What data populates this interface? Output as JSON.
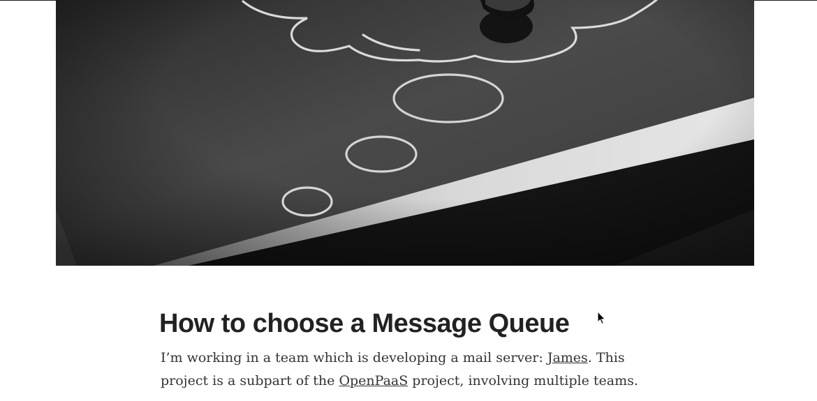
{
  "hero_image": {
    "alt": "",
    "icon": "chalkboard-thought-bubble-image"
  },
  "post": {
    "title": "How to choose a Message Queue",
    "paragraph": {
      "before_james": "I’m working in a team which is developing a mail server: ",
      "james_link": "James",
      "after_james": ". This project is a subpart of the ",
      "openpaas_link": "OpenPaaS",
      "after_openpaas": " project, involving multiple teams."
    }
  },
  "colors": {
    "title": "#222222",
    "text": "#333333",
    "link": "#333333"
  }
}
